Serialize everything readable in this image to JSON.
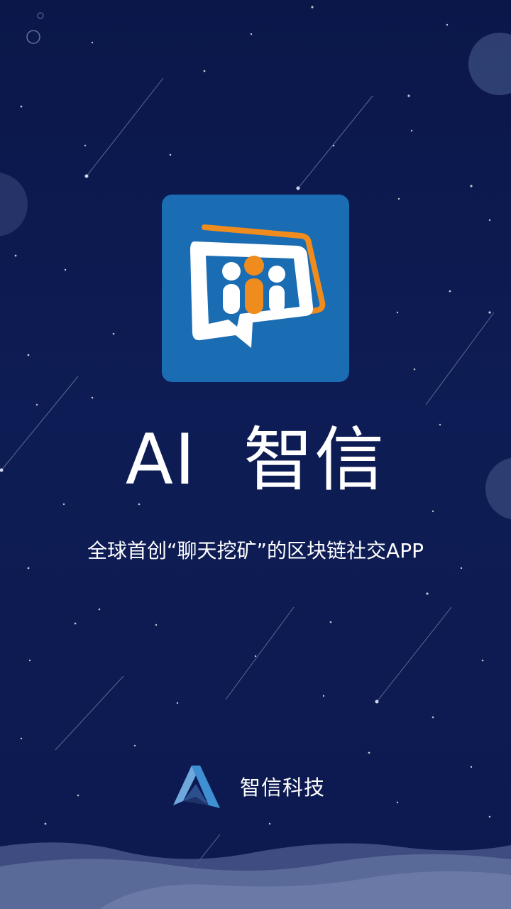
{
  "splash": {
    "title": "AI  智信",
    "tagline": "全球首创“聊天挖矿”的区块链社交APP",
    "company_name": "智信科技"
  },
  "icons": {
    "app_logo": "chat-group-icon",
    "company_logo": "triangle-a-logo-icon"
  },
  "colors": {
    "background": "#0d1a52",
    "app_icon_bg": "#1a6cb3",
    "app_icon_accent": "#f08c1e",
    "text": "#ffffff",
    "logo_blue": "#3f8fd3",
    "wave": "#5d6e9a"
  }
}
